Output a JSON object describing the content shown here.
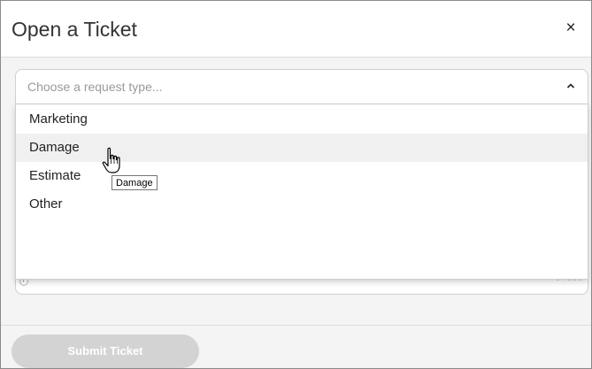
{
  "dialog": {
    "title": "Open a Ticket",
    "close_symbol": "×"
  },
  "request_type": {
    "placeholder": "Choose a request type...",
    "expanded": true,
    "options": [
      {
        "label": "Marketing"
      },
      {
        "label": "Damage"
      },
      {
        "label": "Estimate"
      },
      {
        "label": "Other"
      }
    ],
    "hovered_option": "Damage"
  },
  "tooltip": {
    "text": "Damage"
  },
  "description": {
    "char_count": "0 / 500"
  },
  "footer": {
    "submit_label": "Submit Ticket"
  },
  "icons": {
    "close": "close-icon",
    "chevron": "chevron-up-icon",
    "clock": "clock-icon",
    "cursor": "hand-pointer-icon"
  },
  "colors": {
    "title_text": "#333333",
    "body_background": "#f4f4f4",
    "submit_disabled": "#d3d3d3",
    "hover_row": "#f0f0f0"
  }
}
